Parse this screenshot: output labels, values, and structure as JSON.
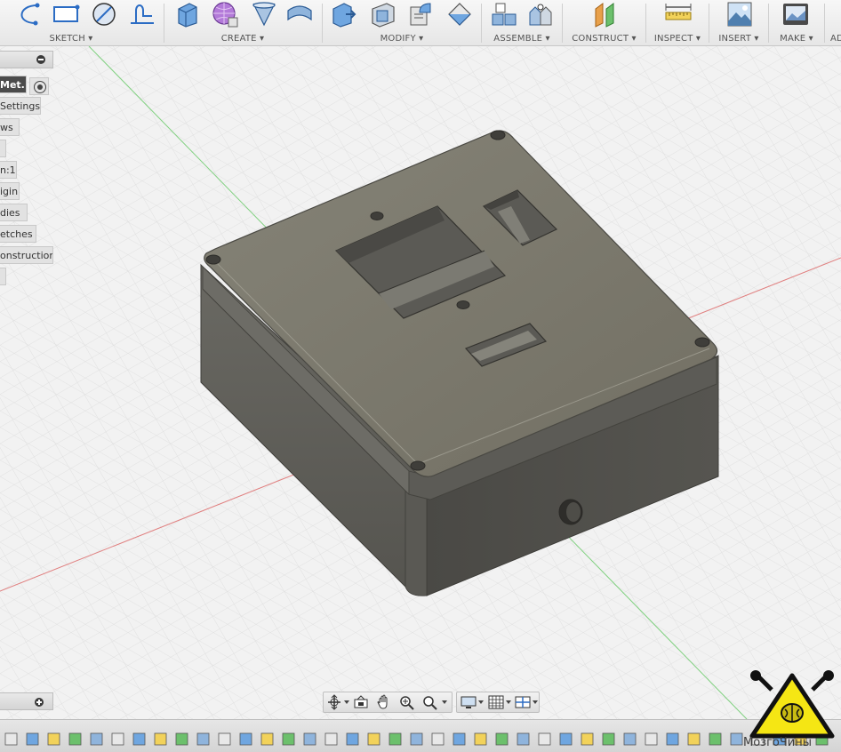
{
  "toolbar": {
    "groups": [
      {
        "id": "sketch",
        "label": "SKETCH ▾"
      },
      {
        "id": "create",
        "label": "CREATE ▾"
      },
      {
        "id": "modify",
        "label": "MODIFY ▾"
      },
      {
        "id": "assemble",
        "label": "ASSEMBLE ▾"
      },
      {
        "id": "construct",
        "label": "CONSTRUCT ▾"
      },
      {
        "id": "inspect",
        "label": "INSPECT ▾"
      },
      {
        "id": "insert",
        "label": "INSERT ▾"
      },
      {
        "id": "make",
        "label": "MAKE ▾"
      },
      {
        "id": "addins",
        "label": "AD"
      }
    ]
  },
  "browser": {
    "items": [
      {
        "label": "Met...",
        "active": true
      },
      {
        "label": "Settings"
      },
      {
        "label": "ws"
      },
      {
        "label": ""
      },
      {
        "label": "n:1"
      },
      {
        "label": "igin"
      },
      {
        "label": "dies"
      },
      {
        "label": "etches"
      },
      {
        "label": "onstruction"
      },
      {
        "label": ""
      }
    ]
  },
  "watermark": {
    "text": "МозгоЧины"
  },
  "icons": {
    "sketch": [
      "arc-icon",
      "rectangle-icon",
      "circle-icon",
      "fit-curve-icon"
    ],
    "create": [
      "extrude-icon",
      "form-icon",
      "revolve-icon",
      "sweep-icon"
    ],
    "modify": [
      "press-pull-icon",
      "shell-icon",
      "fillet-icon",
      "chamfer-icon"
    ],
    "assemble": [
      "new-component-icon",
      "joint-icon"
    ],
    "construct": [
      "offset-plane-icon"
    ],
    "inspect": [
      "measure-icon"
    ],
    "insert": [
      "insert-image-icon"
    ],
    "make": [
      "3d-print-icon"
    ],
    "navigation": [
      "orbit-icon",
      "look-at-icon",
      "pan-icon",
      "zoom-icon",
      "fit-icon",
      "display-settings-icon",
      "grid-icon",
      "viewports-icon"
    ]
  },
  "colors": {
    "viewport_bg": "#f1f1f1",
    "grid": "#d9d9d9",
    "x_axis": "#e08a8a",
    "y_axis": "#8ad08a",
    "box_top": "#7c7a6f",
    "box_side_left": "#5e5d57",
    "box_side_right": "#4e4d48",
    "watermark_yellow": "#f5e614"
  }
}
